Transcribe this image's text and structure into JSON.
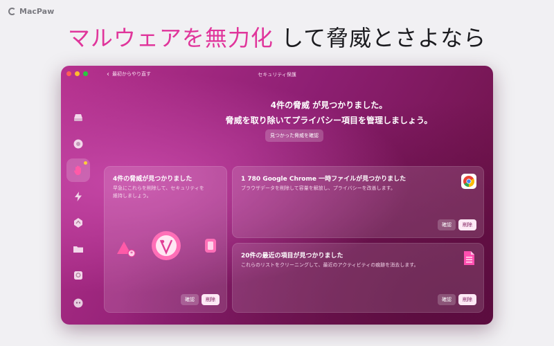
{
  "brand": {
    "name": "MacPaw"
  },
  "headline": {
    "accent": "マルウェアを無力化",
    "rest": "して脅威とさよなら"
  },
  "window": {
    "title": "セキュリティ保護",
    "back_label": "最初からやり直す"
  },
  "summary": {
    "line1": "4件の脅威 が見つかりました。",
    "line2": "脅威を取り除いてプライバシー項目を管理しましょう。",
    "review_button": "見つかった脅威を確認"
  },
  "sidebar": {
    "items": [
      {
        "icon": "disk-cleanup-icon"
      },
      {
        "icon": "protection-shield-icon"
      },
      {
        "icon": "malware-hand-icon",
        "active": true,
        "badge": true
      },
      {
        "icon": "speed-bolt-icon"
      },
      {
        "icon": "applications-icon"
      },
      {
        "icon": "files-folder-icon"
      },
      {
        "icon": "space-lens-icon"
      },
      {
        "icon": "assistant-icon"
      }
    ]
  },
  "cards": {
    "threats": {
      "title": "4件の脅威が見つかりました",
      "desc1": "早急にこれらを削除して、セキュリティを",
      "desc2": "維持しましょう。",
      "review": "確認",
      "remove": "削除"
    },
    "chrome": {
      "title": "1 780 Google Chrome 一時ファイルが見つかりました",
      "desc": "ブラウザデータを削除して容量を解放し、プライバシーを改善します。",
      "review": "確認",
      "remove": "削除",
      "icon": "chrome-icon"
    },
    "recent": {
      "title": "20件の最近の項目が見つかりました",
      "desc": "これらのリストをクリーニングして、最近のアクティビティの痕跡を消去します。",
      "review": "確認",
      "remove": "削除",
      "icon": "document-list-icon"
    }
  },
  "colors": {
    "accent": "#e0359b",
    "window_start": "#b7328f",
    "window_end": "#66103f"
  }
}
